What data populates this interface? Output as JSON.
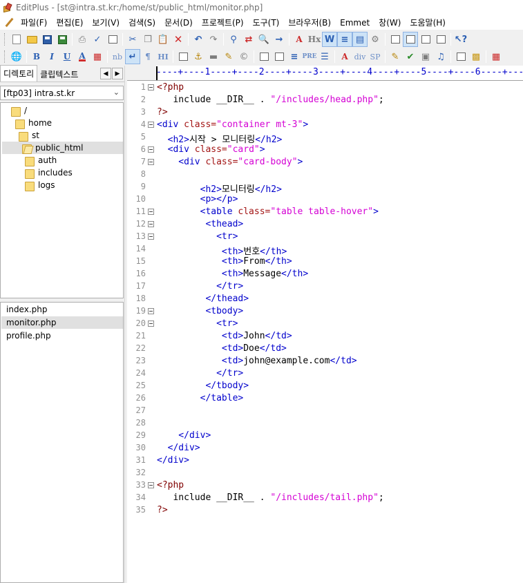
{
  "window": {
    "title": "EditPlus - [st@intra.st.kr:/home/st/public_html/monitor.php]"
  },
  "menu": [
    "파일(F)",
    "편집(E)",
    "보기(V)",
    "검색(S)",
    "문서(D)",
    "프로젝트(P)",
    "도구(T)",
    "브라우저(B)",
    "Emmet",
    "창(W)",
    "도움말(H)"
  ],
  "toolbar2_labels": {
    "bold": "B",
    "italic": "I",
    "underline": "U",
    "font_color": "A",
    "nbsp": "nb",
    "para": "¶",
    "hx": "Hx",
    "hi": "HI",
    "pre": "PRE",
    "div": "div",
    "sp": "SP"
  },
  "left_panel": {
    "tabs": [
      "디렉토리",
      "클립텍스트"
    ],
    "ftp_account": "[ftp03] intra.st.kr",
    "tree": [
      "/",
      "home",
      "st",
      "public_html",
      "auth",
      "includes",
      "logs"
    ],
    "files": [
      "index.php",
      "monitor.php",
      "profile.php"
    ]
  },
  "editor": {
    "ruler": "----+----1----+----2----+----3----+----4----+----5----+----6----+----",
    "lines": [
      [
        [
          "p",
          "<?php"
        ]
      ],
      [
        [
          "h",
          "   include __DIR__ . "
        ],
        [
          "s",
          "\"/includes/head.php\""
        ],
        [
          "h",
          ";"
        ]
      ],
      [
        [
          "p",
          "?>"
        ]
      ],
      [
        [
          "t",
          "<div "
        ],
        [
          "a",
          "class="
        ],
        [
          "s",
          "\"container mt-3\""
        ],
        [
          "t",
          ">"
        ]
      ],
      [
        [
          "t",
          "  <h2>"
        ],
        [
          "h",
          "시작 > 모니터링"
        ],
        [
          "t",
          "</h2>"
        ]
      ],
      [
        [
          "t",
          "  <div "
        ],
        [
          "a",
          "class="
        ],
        [
          "s",
          "\"card\""
        ],
        [
          "t",
          ">"
        ]
      ],
      [
        [
          "t",
          "    <div "
        ],
        [
          "a",
          "class="
        ],
        [
          "s",
          "\"card-body\""
        ],
        [
          "t",
          ">"
        ]
      ],
      [],
      [
        [
          "t",
          "        <h2>"
        ],
        [
          "h",
          "모니터링"
        ],
        [
          "t",
          "</h2>"
        ]
      ],
      [
        [
          "t",
          "        <p></p>"
        ]
      ],
      [
        [
          "t",
          "        <table "
        ],
        [
          "a",
          "class="
        ],
        [
          "s",
          "\"table table-hover\""
        ],
        [
          "t",
          ">"
        ]
      ],
      [
        [
          "t",
          "         <thead>"
        ]
      ],
      [
        [
          "t",
          "           <tr>"
        ]
      ],
      [
        [
          "t",
          "            <th>"
        ],
        [
          "h",
          "번호"
        ],
        [
          "t",
          "</th>"
        ]
      ],
      [
        [
          "t",
          "            <th>"
        ],
        [
          "h",
          "From"
        ],
        [
          "t",
          "</th>"
        ]
      ],
      [
        [
          "t",
          "            <th>"
        ],
        [
          "h",
          "Message"
        ],
        [
          "t",
          "</th>"
        ]
      ],
      [
        [
          "t",
          "           </tr>"
        ]
      ],
      [
        [
          "t",
          "         </thead>"
        ]
      ],
      [
        [
          "t",
          "         <tbody>"
        ]
      ],
      [
        [
          "t",
          "           <tr>"
        ]
      ],
      [
        [
          "t",
          "            <td>"
        ],
        [
          "h",
          "John"
        ],
        [
          "t",
          "</td>"
        ]
      ],
      [
        [
          "t",
          "            <td>"
        ],
        [
          "h",
          "Doe"
        ],
        [
          "t",
          "</td>"
        ]
      ],
      [
        [
          "t",
          "            <td>"
        ],
        [
          "h",
          "john@example.com"
        ],
        [
          "t",
          "</td>"
        ]
      ],
      [
        [
          "t",
          "           </tr>"
        ]
      ],
      [
        [
          "t",
          "         </tbody>"
        ]
      ],
      [
        [
          "t",
          "        </table>"
        ]
      ],
      [],
      [],
      [
        [
          "t",
          "    </div>"
        ]
      ],
      [
        [
          "t",
          "  </div>"
        ]
      ],
      [
        [
          "t",
          "</div>"
        ]
      ],
      [],
      [
        [
          "p",
          "<?php"
        ]
      ],
      [
        [
          "h",
          "   include __DIR__ . "
        ],
        [
          "s",
          "\"/includes/tail.php\""
        ],
        [
          "h",
          ";"
        ]
      ],
      [
        [
          "p",
          "?>"
        ]
      ]
    ],
    "fold_lines": [
      1,
      4,
      6,
      7,
      11,
      12,
      13,
      19,
      20,
      33
    ]
  },
  "colors": {
    "tag": "#0000cc",
    "attribute": "#a31515",
    "string": "#d400d4",
    "php_delim": "#800000",
    "line_number": "#909090"
  }
}
